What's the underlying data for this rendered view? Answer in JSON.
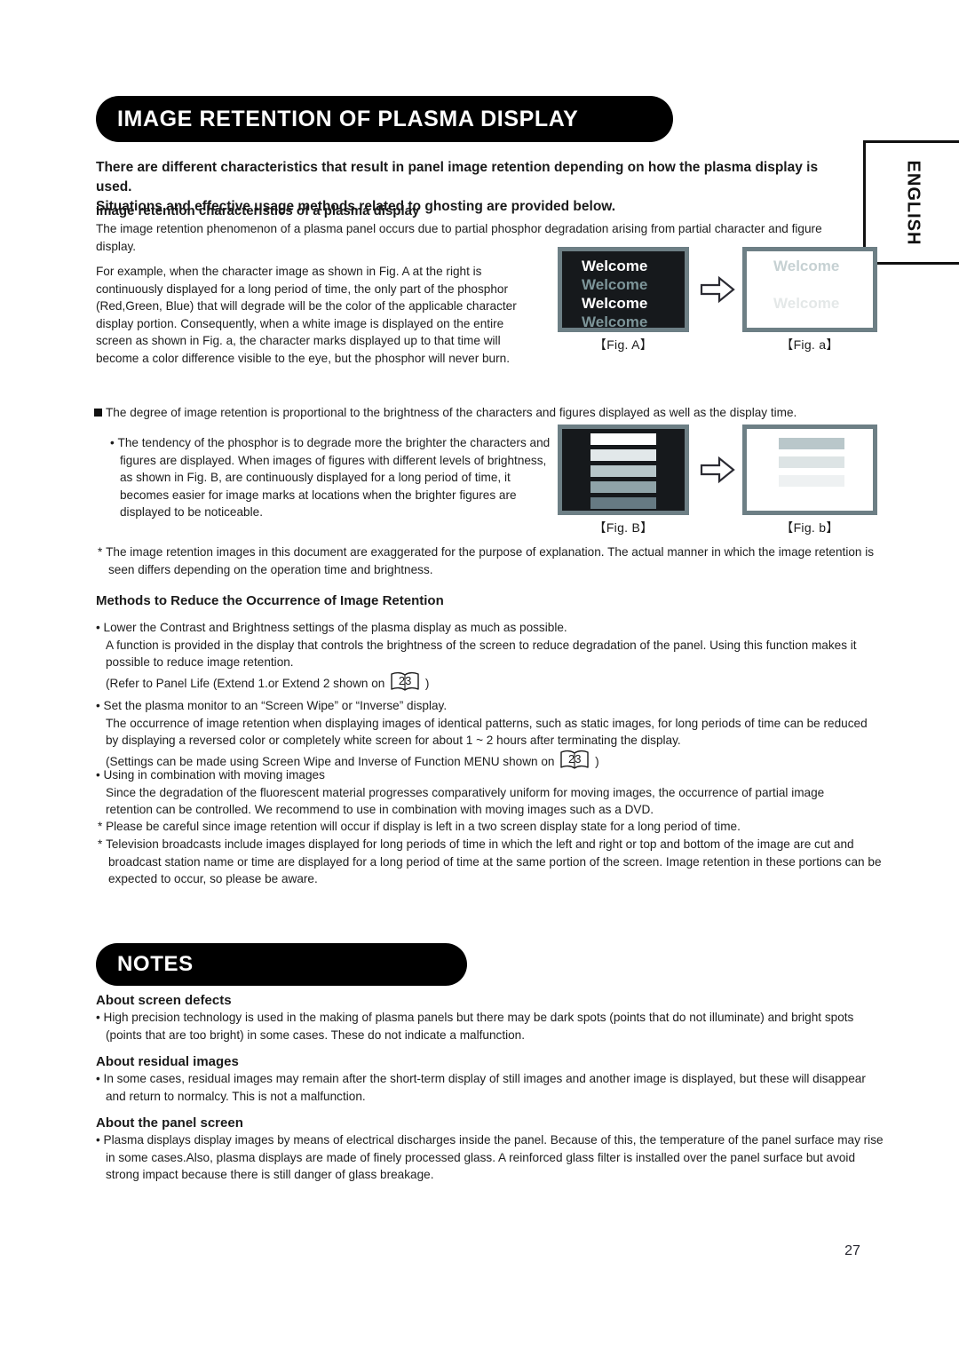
{
  "document": {
    "page_number": "27",
    "language_tab": "ENGLISH"
  },
  "main_section": {
    "title": "IMAGE RETENTION OF PLASMA DISPLAY",
    "lead_line1": "There are different characteristics that result in panel image retention depending on how the plasma display is used.",
    "lead_line2": "Situations and effective usage methods related to ghosting are provided below.",
    "heading_characteristics": "Image retention characteristics of a plasma display",
    "para_phenomenon": "The image retention phenomenon of a plasma panel occurs due to partial phosphor degradation arising from partial character and figure display.",
    "para_example": "For example, when the character image as shown in Fig. A at the right is continuously displayed for a long period of time, the only part of the phosphor (Red,Green, Blue) that will degrade will be the color of the applicable character display portion. Consequently, when a white image is displayed on the entire screen as shown in Fig. a, the character marks displayed up to that time will become a color difference visible to the eye, but the phosphor will never burn.",
    "square_note": "The degree of image retention is proportional to the brightness of the characters and figures displayed as well as the display time.",
    "bullet_tendency": "The tendency of the phosphor is to degrade more the brighter the characters and figures are displayed. When images of figures with different levels of brightness, as shown in Fig. B, are continuously displayed for a long period of time, it becomes easier for image marks at locations when the brighter figures are displayed to be noticeable.",
    "asterisk_exaggerated": "The image retention images in this document are exaggerated for the purpose of explanation. The actual manner in which the image retention is seen differs depending on the operation time and brightness."
  },
  "figures": {
    "fig_a_caption": "【Fig. A】",
    "fig_a_small_caption": "【Fig. a】",
    "fig_b_caption": "【Fig. B】",
    "fig_b_small_caption": "【Fig. b】",
    "welcome_text": "Welcome",
    "fig_a_lines": [
      {
        "text": "Welcome",
        "color": "#ffffff"
      },
      {
        "text": "Welcome",
        "color": "#7d9599"
      },
      {
        "text": "Welcome",
        "color": "#ffffff"
      },
      {
        "text": "Welcome",
        "color": "#7d9599"
      }
    ],
    "fig_a_small_lines": [
      {
        "text": "Welcome",
        "color": "#c6d1d3"
      },
      {
        "text": "Welcome",
        "color": "#e4e8e8"
      }
    ],
    "fig_b_bars": [
      "#ffffff",
      "#e2e8ea",
      "#b7c6c9",
      "#8fa3a8",
      "#667a83"
    ],
    "fig_b_small_bars": [
      "#b9c7ca",
      "#dde4e5",
      "#eef1f2"
    ],
    "screen_frame_color": "#6d7f85",
    "screen_dark_color": "#16191c",
    "arrow_glyph": "arrow-right"
  },
  "methods_section": {
    "heading": "Methods to Reduce the Occurrence of Image Retention",
    "bullet1_line1": "Lower the Contrast and Brightness settings of the plasma display as much as possible.",
    "bullet1_line2": "A function is provided in the display that controls the brightness of the screen to reduce degradation of the panel. Using this function makes it possible to reduce image retention.",
    "bullet1_ref_prefix": "(Refer to Panel Life (Extend 1.or Extend 2 shown on",
    "bullet1_ref_page": "23",
    "bullet1_ref_suffix": ")",
    "bullet2_line1": "Set the plasma monitor to an “Screen Wipe” or “Inverse” display.",
    "bullet2_line2": "The occurrence of image retention when displaying images of identical patterns, such as static images, for long periods of time can be reduced by displaying a reversed color or completely white screen for about 1 ~ 2 hours after terminating the display.",
    "bullet2_ref_prefix": "(Settings can be made using Screen Wipe and Inverse of Function MENU shown on",
    "bullet2_ref_page": "23",
    "bullet2_ref_suffix": ")",
    "bullet3_line1": "Using in combination with moving images",
    "bullet3_line2": "Since the degradation of the fluorescent material progresses comparatively uniform for moving images, the occurrence of partial image retention can be controlled. We recommend to use in combination with moving images such as a DVD.",
    "asterisk1": "Please be careful since image retention will occur if display is left in a two screen display state for a long period of time.",
    "asterisk2": "Television broadcasts include images displayed for long periods of time in which the left and right or top and bottom of the image are cut and broadcast station name or time are displayed for a long period of time at the same portion of the screen. Image retention in these portions can be expected to occur, so please be aware."
  },
  "notes_section": {
    "title": "NOTES",
    "heading_screen_defects": "About screen defects",
    "text_screen_defects": "High precision technology is used in the making of plasma panels but there may be dark spots (points that do not illuminate) and bright spots (points that are too bright) in some cases. These do not indicate a malfunction.",
    "heading_residual_images": "About residual images",
    "text_residual_images": "In some cases, residual images may remain after the short-term display of still images and another image is displayed, but these will disappear and return to normalcy. This is not a malfunction.",
    "heading_panel_screen": "About the panel screen",
    "text_panel_screen": "Plasma displays display images by means of electrical discharges inside the panel. Because of this, the temperature of the panel surface may rise in some cases.Also, plasma displays are made of finely processed glass. A reinforced glass filter is installed over the panel surface but avoid strong impact because there is still danger of glass breakage."
  }
}
